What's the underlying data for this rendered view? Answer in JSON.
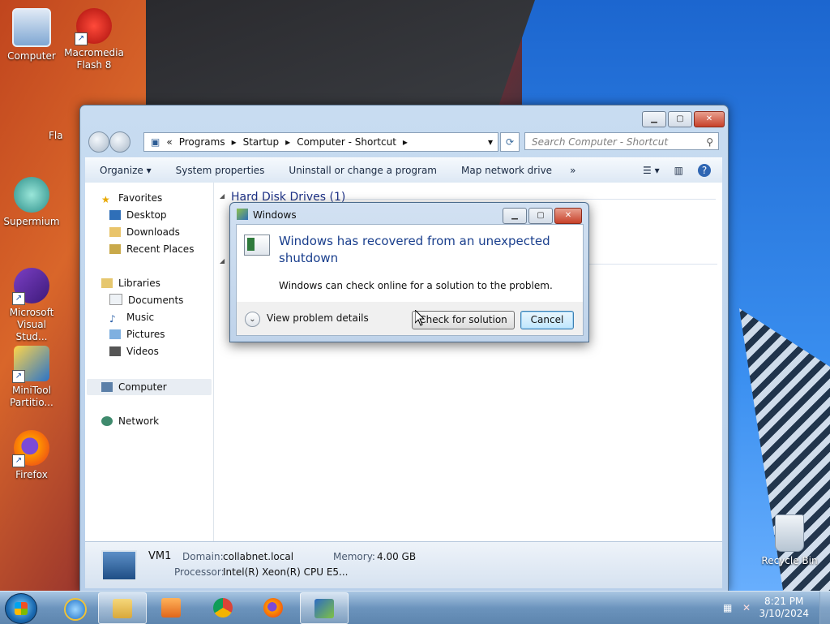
{
  "desktop": {
    "icons": [
      {
        "label": "Computer",
        "icon": "computer-icon"
      },
      {
        "label": "Macromedia Flash 8",
        "icon": "flash-icon"
      },
      {
        "label": "Supermium",
        "icon": "supermium-icon"
      },
      {
        "label": "Microsoft Visual Stud...",
        "icon": "visual-studio-icon"
      },
      {
        "label": "MiniTool Partitio...",
        "icon": "minitool-icon"
      },
      {
        "label": "Firefox",
        "icon": "firefox-icon"
      },
      {
        "label": "Recycle Bin",
        "icon": "recycle-bin-icon"
      }
    ],
    "partial_label": "Fla"
  },
  "explorer": {
    "breadcrumb": [
      "Programs",
      "Startup",
      "Computer - Shortcut"
    ],
    "search_placeholder": "Search Computer - Shortcut",
    "toolbar": {
      "organize": "Organize",
      "system_properties": "System properties",
      "uninstall": "Uninstall or change a program",
      "map_drive": "Map network drive",
      "more": "»"
    },
    "nav": {
      "favorites": "Favorites",
      "desktop": "Desktop",
      "downloads": "Downloads",
      "recent": "Recent Places",
      "libraries": "Libraries",
      "documents": "Documents",
      "music": "Music",
      "pictures": "Pictures",
      "videos": "Videos",
      "computer": "Computer",
      "network": "Network"
    },
    "group_heading": "Hard Disk Drives (1)",
    "details": {
      "name": "VM1",
      "domain_label": "Domain:",
      "domain_value": "collabnet.local",
      "memory_label": "Memory:",
      "memory_value": "4.00 GB",
      "processor_label": "Processor:",
      "processor_value": "Intel(R) Xeon(R) CPU E5..."
    }
  },
  "dialog": {
    "title": "Windows",
    "heading": "Windows has recovered from an unexpected shutdown",
    "message": "Windows can check online for a solution to the problem.",
    "view_details": "View problem details",
    "check_button": "Check for solution",
    "cancel_button": "Cancel"
  },
  "taskbar": {
    "time": "8:21 PM",
    "date": "3/10/2024",
    "apps": [
      "internet-explorer-icon",
      "windows-explorer-icon",
      "media-player-icon",
      "chrome-icon",
      "firefox-icon",
      "action-center-icon"
    ]
  },
  "colors": {
    "accent_heading": "#1a3f8d",
    "taskbar": "#6c94bd"
  }
}
